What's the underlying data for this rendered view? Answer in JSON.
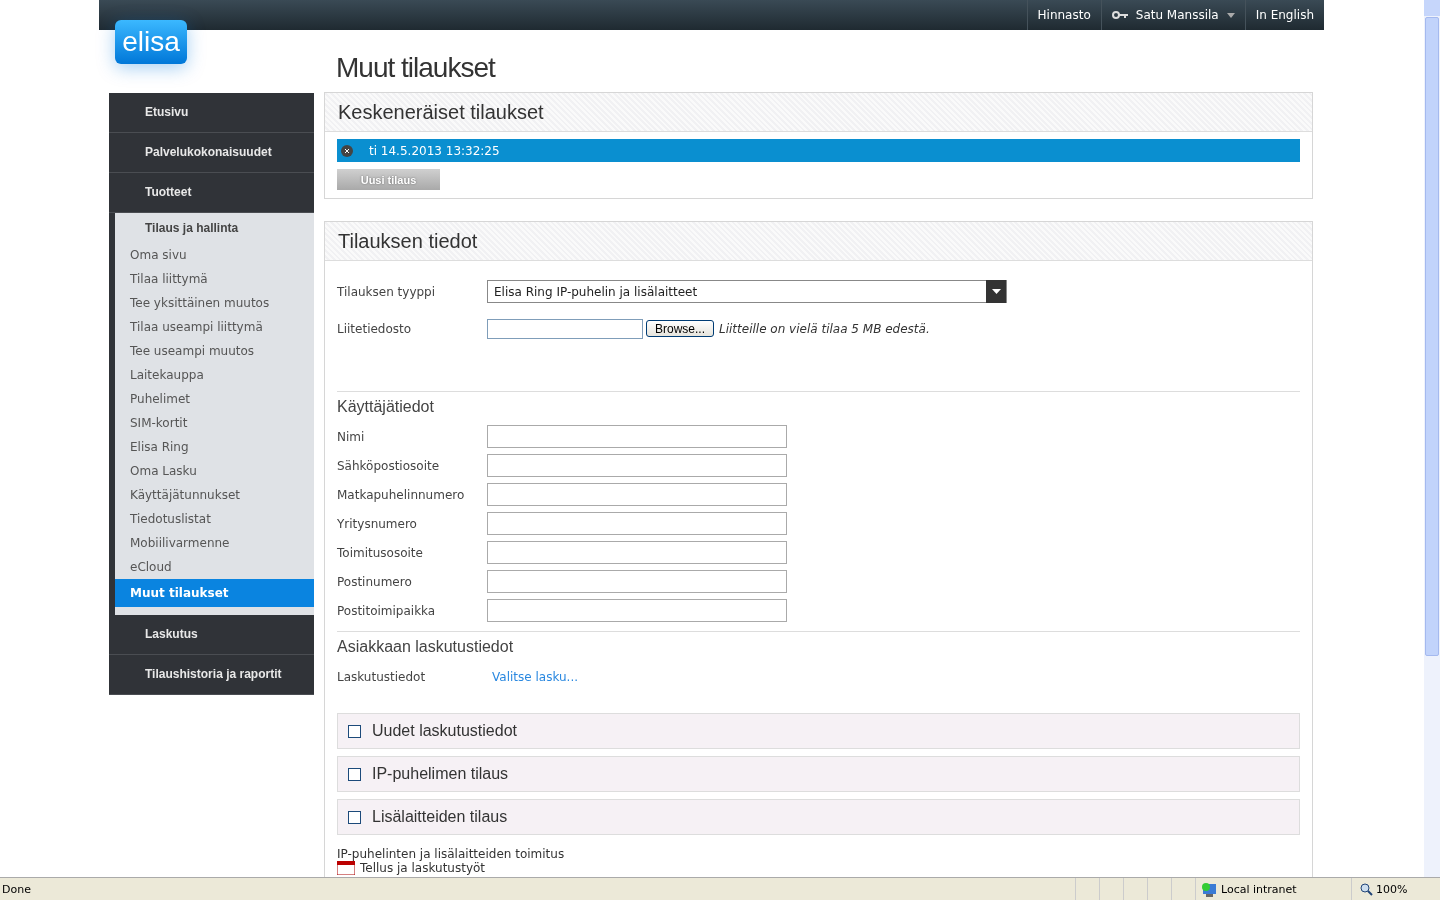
{
  "topbar": {
    "links": [
      "Hinnasto"
    ],
    "user": "Satu Manssila",
    "language": "In English"
  },
  "logo": "elisa",
  "sidebar": {
    "items": [
      {
        "label": "Etusivu",
        "expanded": false
      },
      {
        "label": "Palvelukokonaisuudet",
        "expanded": false
      },
      {
        "label": "Tuotteet",
        "expanded": false
      },
      {
        "label": "Tilaus ja hallinta",
        "expanded": true,
        "children": [
          {
            "label": "Oma sivu",
            "selected": false
          },
          {
            "label": "Tilaa liittymä",
            "selected": false
          },
          {
            "label": "Tee yksittäinen muutos",
            "selected": false
          },
          {
            "label": "Tilaa useampi liittymä",
            "selected": false
          },
          {
            "label": "Tee useampi muutos",
            "selected": false
          },
          {
            "label": "Laitekauppa",
            "selected": false
          },
          {
            "label": "Puhelimet",
            "selected": false
          },
          {
            "label": "SIM-kortit",
            "selected": false
          },
          {
            "label": "Elisa Ring",
            "selected": false
          },
          {
            "label": "Oma Lasku",
            "selected": false
          },
          {
            "label": "Käyttäjätunnukset",
            "selected": false
          },
          {
            "label": "Tiedotuslistat",
            "selected": false
          },
          {
            "label": "Mobiilivarmenne",
            "selected": false
          },
          {
            "label": "eCloud",
            "selected": false
          },
          {
            "label": "Muut tilaukset",
            "selected": true
          }
        ]
      },
      {
        "label": "Laskutus",
        "expanded": false
      },
      {
        "label": "Tilaushistoria ja raportit",
        "expanded": false
      }
    ]
  },
  "page_title": "Muut tilaukset",
  "pending_orders": {
    "title": "Keskeneräiset tilaukset",
    "orders": [
      {
        "label": "ti 14.5.2013 13:32:25",
        "selected": true
      }
    ],
    "new_order_button": {
      "label": "Uusi tilaus",
      "disabled": true
    }
  },
  "order_details": {
    "title": "Tilauksen tiedot",
    "order_type": {
      "label": "Tilauksen tyyppi",
      "value": "Elisa Ring IP-puhelin ja lisälaitteet"
    },
    "attachment": {
      "label": "Liitetiedosto",
      "button": "Browse...",
      "note": "Liitteille on vielä tilaa 5 MB edestä."
    },
    "user_info": {
      "title": "Käyttäjätiedot",
      "fields": [
        "Nimi",
        "Sähköpostiosoite",
        "Matkapuhelinnumero",
        "Yritysnumero",
        "Toimitusosoite",
        "Postinumero",
        "Postitoimipaikka"
      ]
    },
    "billing": {
      "title": "Asiakkaan laskutustiedot",
      "label": "Laskutustiedot",
      "link": "Valitse lasku..."
    },
    "sections": [
      {
        "label": "Uudet laskutustiedot",
        "checked": false
      },
      {
        "label": "IP-puhelimen tilaus",
        "checked": false
      },
      {
        "label": "Lisälaitteiden tilaus",
        "checked": false
      }
    ],
    "delivery": {
      "label": "IP-puhelinten ja lisälaitteiden toimitus",
      "item": "Tellus ja laskutustyöt"
    }
  },
  "status_bar": {
    "status": "Done",
    "zone": "Local intranet",
    "zoom": "100%"
  }
}
